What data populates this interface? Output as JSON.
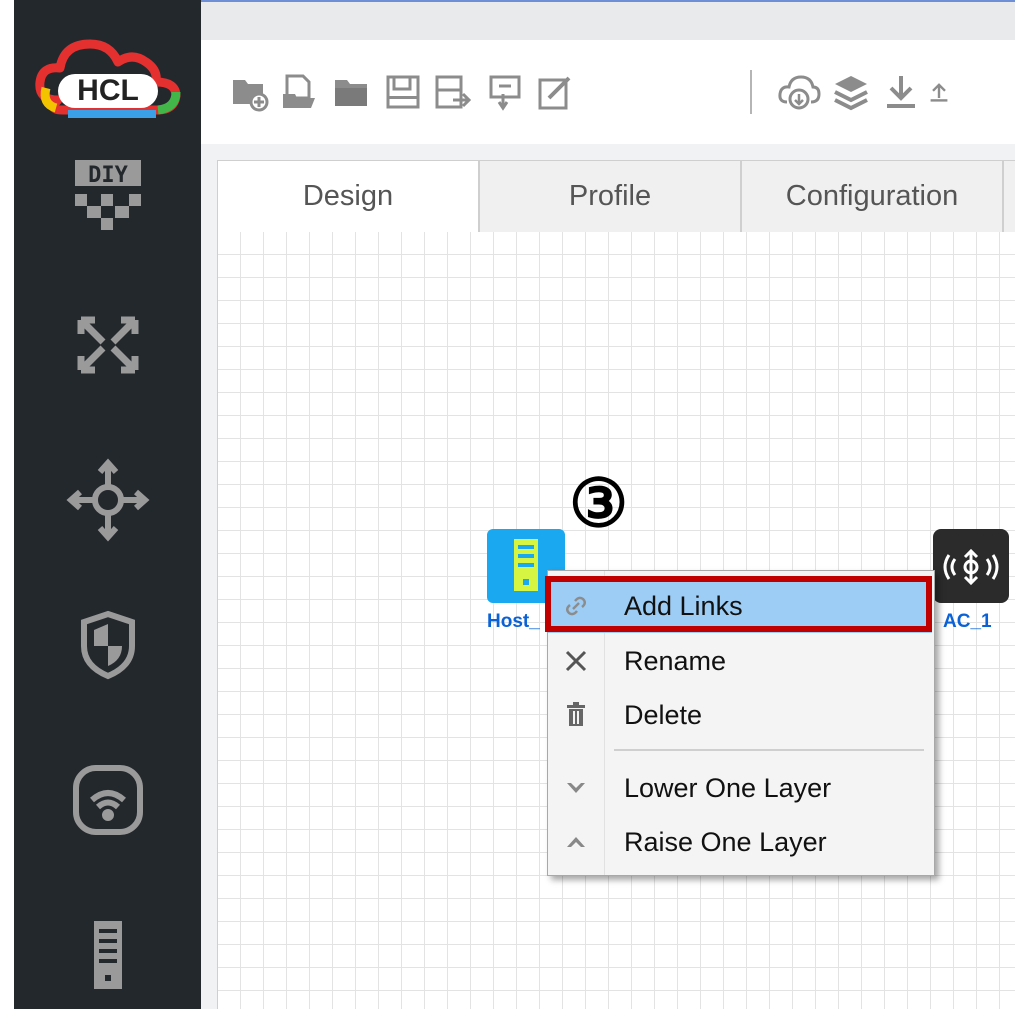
{
  "app": {
    "logo_text": "HCL"
  },
  "sidebar": {
    "items": [
      {
        "icon": "diy-icon",
        "label": "DIY"
      },
      {
        "icon": "switch-icon"
      },
      {
        "icon": "router-icon"
      },
      {
        "icon": "firewall-shield-icon"
      },
      {
        "icon": "wireless-icon"
      },
      {
        "icon": "host-terminal-icon"
      }
    ]
  },
  "toolbar": {
    "icons": [
      "new-project-icon",
      "open-file-icon",
      "open-folder-icon",
      "save-icon",
      "save-as-icon",
      "export-icon",
      "edit-icon",
      "cloud-download-icon",
      "layers-icon",
      "download-icon",
      "upload-icon"
    ]
  },
  "tabs": [
    {
      "label": "Design"
    },
    {
      "label": "Profile"
    },
    {
      "label": "Configuration"
    }
  ],
  "devices": {
    "host": {
      "label": "Host_"
    },
    "ac": {
      "label": "AC_1"
    }
  },
  "annotation": {
    "step": "③"
  },
  "context_menu": {
    "items": [
      {
        "label": "Add Links",
        "icon": "link-icon",
        "highlighted": true
      },
      {
        "label": "Rename",
        "icon": "rename-icon"
      },
      {
        "label": "Delete",
        "icon": "trash-icon"
      },
      {
        "label": "Lower One Layer",
        "icon": "chevron-down-icon"
      },
      {
        "label": "Raise One Layer",
        "icon": "chevron-up-icon"
      }
    ]
  },
  "colors": {
    "sidebar_bg": "#23282d",
    "highlight_bg": "#9dcdf5",
    "annotation_frame": "#c00000",
    "host_color": "#1aa8f0",
    "label_color": "#0a62d6"
  }
}
